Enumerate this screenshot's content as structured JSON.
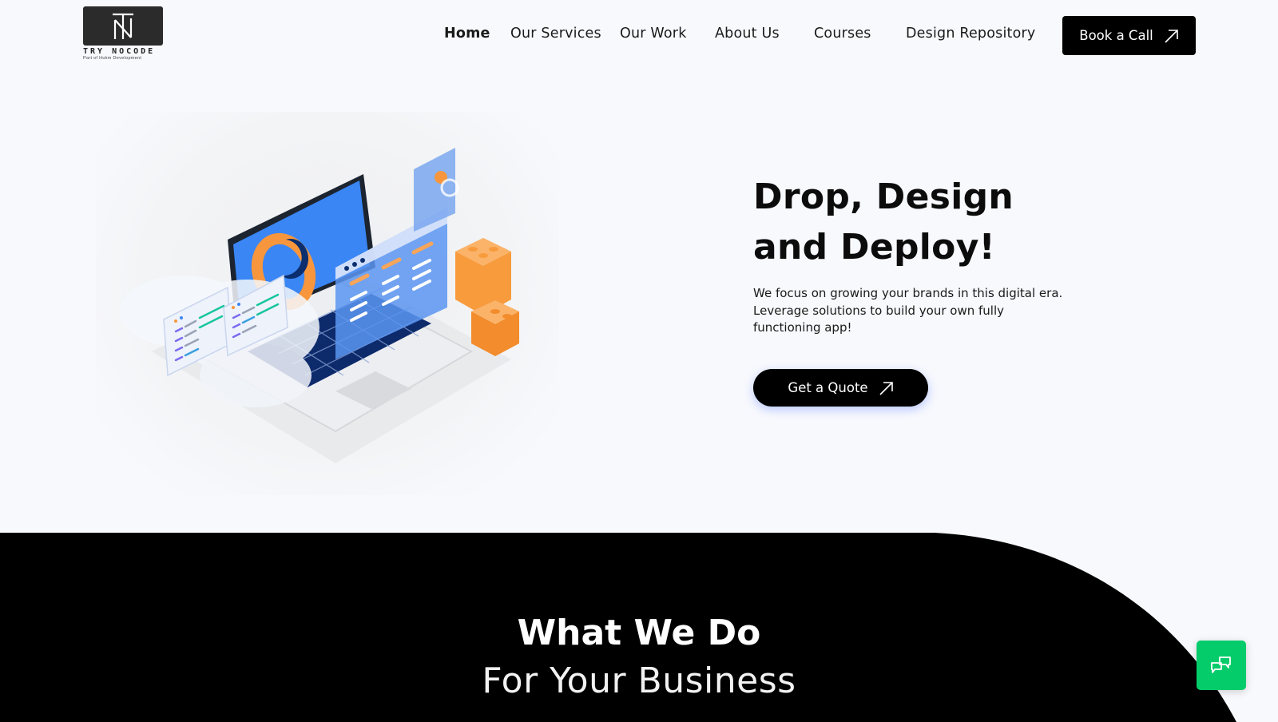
{
  "brand": {
    "name": "TRY NOCODE",
    "tagline": "Part of Hukm Development",
    "logo_icon": "tn-monogram-icon"
  },
  "nav": {
    "items": [
      {
        "label": "Home",
        "active": true
      },
      {
        "label": "Our Services",
        "active": false
      },
      {
        "label": "Our Work",
        "active": false
      },
      {
        "label": "About Us",
        "active": false
      },
      {
        "label": "Courses",
        "active": false
      },
      {
        "label": "Design Repository",
        "active": false
      }
    ],
    "cta": {
      "label": "Book a Call",
      "icon": "arrow-up-right-icon"
    }
  },
  "hero": {
    "title_line1": "Drop, Design",
    "title_line2": "and Deploy!",
    "description": "We focus on growing your brands in this digital era. Leverage solutions to build your own fully functioning app!",
    "cta": {
      "label": "Get a Quote",
      "icon": "arrow-up-right-icon"
    },
    "illustration": "isometric-laptop-app-builder-illustration"
  },
  "what_we_do": {
    "title": "What We Do",
    "subtitle": "For Your Business"
  },
  "chat_widget": {
    "icon": "chat-bubbles-icon"
  },
  "colors": {
    "page_background": "#f8f9fd",
    "primary_black": "#000000",
    "chat_green": "#05cc6a",
    "accent_blue": "#3b82f6",
    "accent_orange": "#f7963c"
  }
}
